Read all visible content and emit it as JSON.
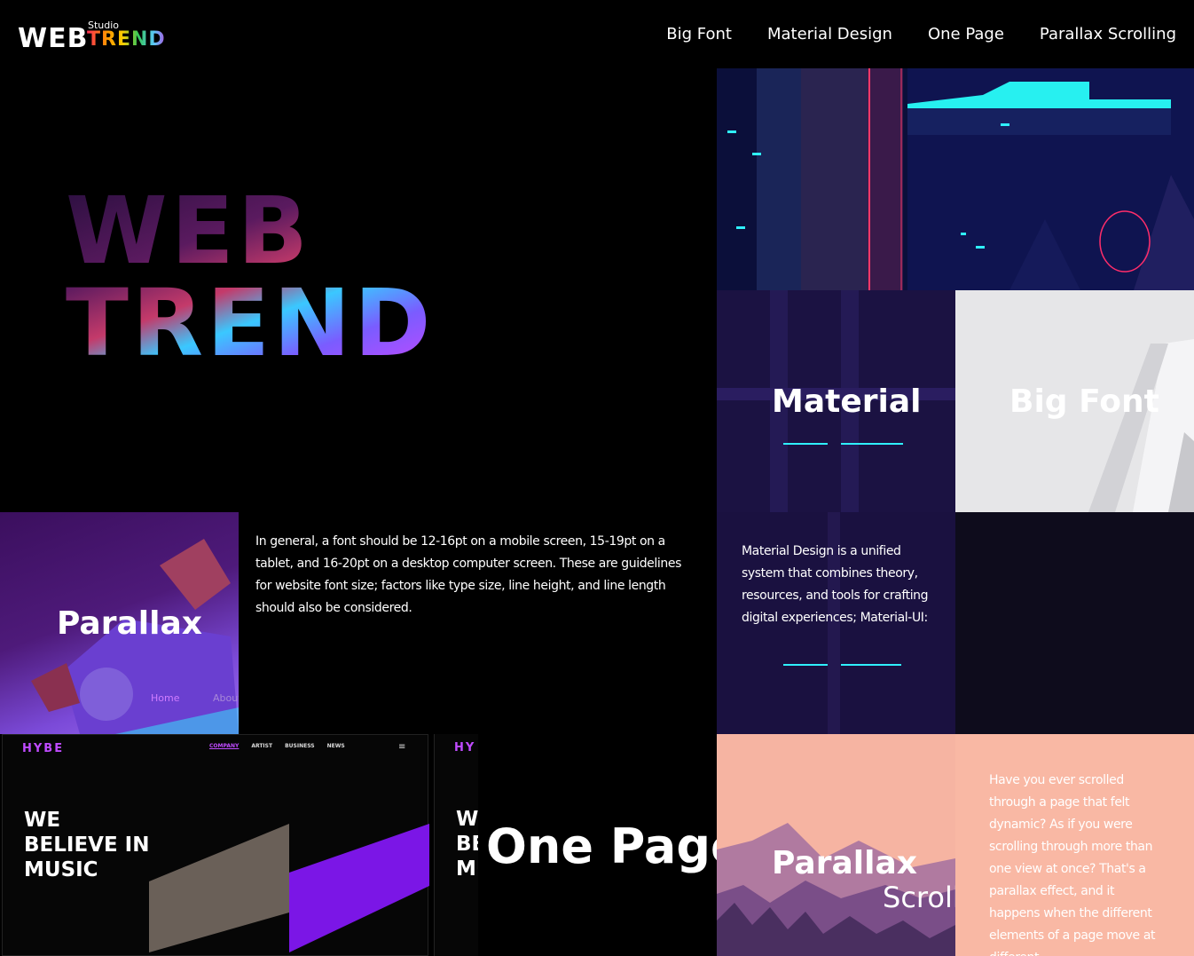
{
  "header": {
    "logo": {
      "main": "WEB",
      "studio": "Studio",
      "trend": "TREND"
    },
    "nav": [
      "Big Font",
      "Material Design",
      "One Page",
      "Parallax Scrolling"
    ]
  },
  "hero": {
    "title": "WEB TREND"
  },
  "tiles": {
    "material": {
      "label": "Material"
    },
    "big_font": {
      "label": "Big Font"
    },
    "material_text": "Material Design is a unified system that combines theory, resources, and tools for crafting digital experiences; Material-UI:",
    "parallax": {
      "label": "Parallax",
      "nav_home": "Home",
      "nav_about": "About"
    },
    "font_text": "In general, a font should be 12-16pt on a mobile screen, 15-19pt on a tablet, and 16-20pt on a desktop computer screen. These are guidelines for website font size; factors like type size, line height, and line length should also be considered.",
    "parallax_scroll": {
      "label": "Parallax",
      "sub": "Scroll"
    },
    "parallax_text": "Have you ever scrolled through a page that felt dynamic? As if you were scrolling through more than one view at once? That's a parallax effect, and it happens when the different elements of a page move at different"
  },
  "hybe": {
    "logo": "HYBE",
    "logo_partial": "HY",
    "nav": [
      "COMPANY",
      "ARTIST",
      "BUSINESS",
      "NEWS"
    ],
    "headline": "WE\nBELIEVE IN\nMUSIC",
    "headline_partial": "W\nBE\nMU"
  },
  "one_page": {
    "label": "One Page"
  },
  "colors": {
    "background": "#000000",
    "accent_purple": "#7b2cff",
    "hybe_purple": "#c04bff",
    "peach": "#f9b8a4",
    "cyan": "#2ff0ff"
  }
}
